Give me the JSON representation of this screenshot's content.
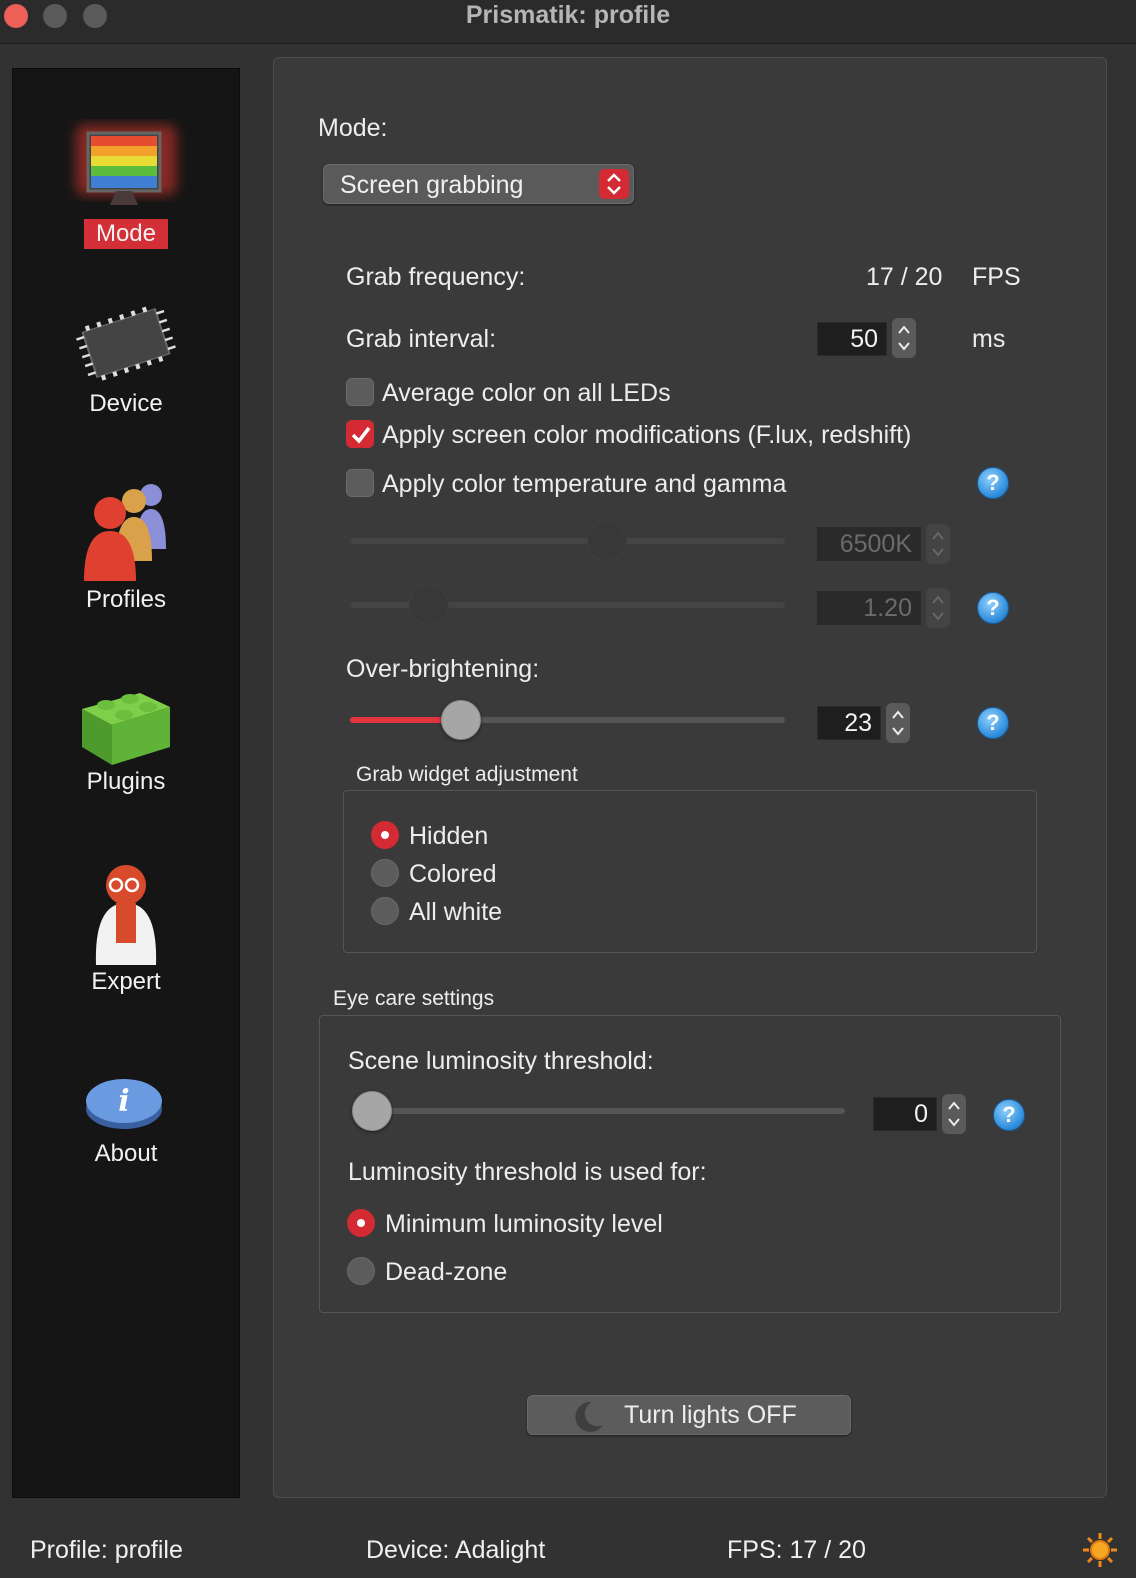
{
  "window": {
    "title": "Prismatik: profile"
  },
  "sidebar": {
    "items": [
      {
        "label": "Mode",
        "icon": "monitor-rainbow-icon",
        "active": true
      },
      {
        "label": "Device",
        "icon": "chip-icon",
        "active": false
      },
      {
        "label": "Profiles",
        "icon": "people-icon",
        "active": false
      },
      {
        "label": "Plugins",
        "icon": "lego-brick-icon",
        "active": false
      },
      {
        "label": "Expert",
        "icon": "scientist-icon",
        "active": false
      },
      {
        "label": "About",
        "icon": "info-icon",
        "active": false
      }
    ]
  },
  "mode": {
    "label": "Mode:",
    "selected": "Screen grabbing"
  },
  "grab": {
    "frequency_label": "Grab frequency:",
    "frequency_value": "17 / 20",
    "frequency_unit": "FPS",
    "interval_label": "Grab interval:",
    "interval_value": "50",
    "interval_unit": "ms",
    "avg_color_label": "Average color on all LEDs",
    "avg_color_checked": false,
    "apply_mods_label": "Apply screen color modifications (F.lux, redshift)",
    "apply_mods_checked": true,
    "color_temp_label": "Apply color temperature and gamma",
    "color_temp_checked": false,
    "temperature_value": "6500K",
    "gamma_value": "1.20",
    "temperature_slider_fraction": 0.6,
    "gamma_slider_fraction": 0.15
  },
  "over_brightening": {
    "label": "Over-brightening:",
    "value": "23",
    "slider_fraction": 0.23
  },
  "grab_widget": {
    "title": "Grab widget adjustment",
    "options": [
      {
        "label": "Hidden",
        "checked": true
      },
      {
        "label": "Colored",
        "checked": false
      },
      {
        "label": "All white",
        "checked": false
      }
    ]
  },
  "eye_care": {
    "title": "Eye care settings",
    "threshold_label": "Scene luminosity threshold:",
    "threshold_value": "0",
    "threshold_slider_fraction": 0.0,
    "used_for_label": "Luminosity threshold is used for:",
    "options": [
      {
        "label": "Minimum luminosity level",
        "checked": true
      },
      {
        "label": "Dead-zone",
        "checked": false
      }
    ]
  },
  "lights_button": {
    "label": "Turn lights OFF",
    "icon": "moon-icon"
  },
  "status_bar": {
    "profile": "Profile: profile",
    "device": "Device: Adalight",
    "fps": "FPS: 17 / 20",
    "state_icon": "sun-icon"
  },
  "colors": {
    "accent": "#d42a33",
    "background": "#3a3a3a",
    "sidebar": "#151515"
  }
}
